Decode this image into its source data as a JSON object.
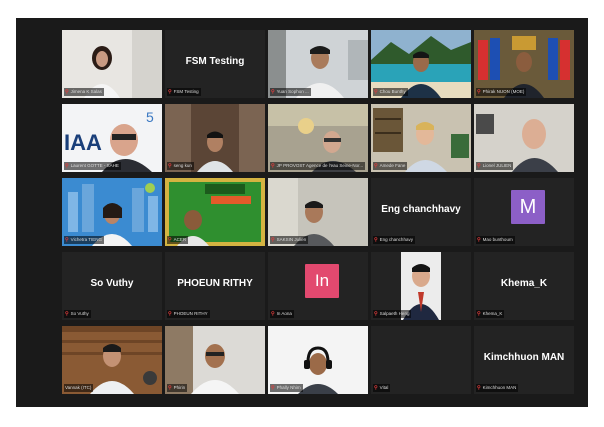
{
  "meeting": {
    "layout": "gallery-view",
    "tiles": [
      {
        "name": "Jimena K Salas",
        "kind": "video",
        "scene": "woman-white",
        "muted": true
      },
      {
        "name": "FSM Testing",
        "kind": "name",
        "muted": true
      },
      {
        "name": "Yuan Sophon ...",
        "kind": "video",
        "scene": "man-office",
        "muted": true
      },
      {
        "name": "Chou Bunthy",
        "kind": "video",
        "scene": "beach",
        "muted": true
      },
      {
        "name": "Phirak NUON (MOE)",
        "kind": "video",
        "scene": "flags",
        "muted": true
      },
      {
        "name": "Laurent GOTTE - SAHE",
        "kind": "video",
        "scene": "logo-man",
        "muted": true
      },
      {
        "name": "seng kun",
        "kind": "video",
        "scene": "man-curtain",
        "muted": true
      },
      {
        "name": "JP PROVOST Agence de l'eau Seine-Nor...",
        "kind": "video",
        "scene": "man-lamp",
        "muted": true
      },
      {
        "name": "Amede Fane",
        "kind": "video",
        "scene": "man-shelf",
        "muted": true
      },
      {
        "name": "Lionel JULIEN",
        "kind": "video",
        "scene": "bald-man",
        "muted": true
      },
      {
        "name": "Vichetra TIENG",
        "kind": "video",
        "scene": "woman-city",
        "muted": true
      },
      {
        "name": "ACER",
        "kind": "video",
        "scene": "green-virtual",
        "muted": true
      },
      {
        "name": "SAKSIN Julien",
        "kind": "video",
        "scene": "man-room",
        "muted": true
      },
      {
        "name": "Eng chanchhavy",
        "kind": "name",
        "label": "Eng chanchhavy",
        "muted": true
      },
      {
        "name": "Mao bunthoum",
        "kind": "avatar",
        "letter": "M",
        "color": "#8c5fc7",
        "muted": true
      },
      {
        "name": "So Vuthy",
        "kind": "name",
        "label": "So Vuthy",
        "muted": true
      },
      {
        "name": "PHOEUN RITHY",
        "kind": "name",
        "label": "PHOEUN RITHY",
        "muted": true
      },
      {
        "name": "In Aona",
        "kind": "avatar",
        "letter": "In",
        "color": "#e2496f",
        "muted": true
      },
      {
        "name": "Salpaeth Heng",
        "kind": "video",
        "scene": "portrait",
        "muted": true
      },
      {
        "name": "Khema_K",
        "kind": "name",
        "label": "Khema_K",
        "muted": true
      },
      {
        "name": "Vannak (ITC)",
        "kind": "video",
        "scene": "man-wood",
        "muted": false,
        "active": true
      },
      {
        "name": "Phirin",
        "kind": "video",
        "scene": "man-glasses",
        "muted": true
      },
      {
        "name": "Phally Nhim",
        "kind": "video",
        "scene": "man-headset",
        "muted": true
      },
      {
        "name": "Vital",
        "kind": "empty",
        "muted": true
      },
      {
        "name": "Kimchhuon MAN",
        "kind": "name",
        "label": "Kimchhuon MAN",
        "muted": true
      }
    ]
  },
  "colors": {
    "background": "#1a1a1a",
    "tile": "#232323",
    "active_border": "#c8c84a",
    "mute_icon": "#e23b3b"
  },
  "icons": {
    "muted": "microphone-muted-icon"
  }
}
